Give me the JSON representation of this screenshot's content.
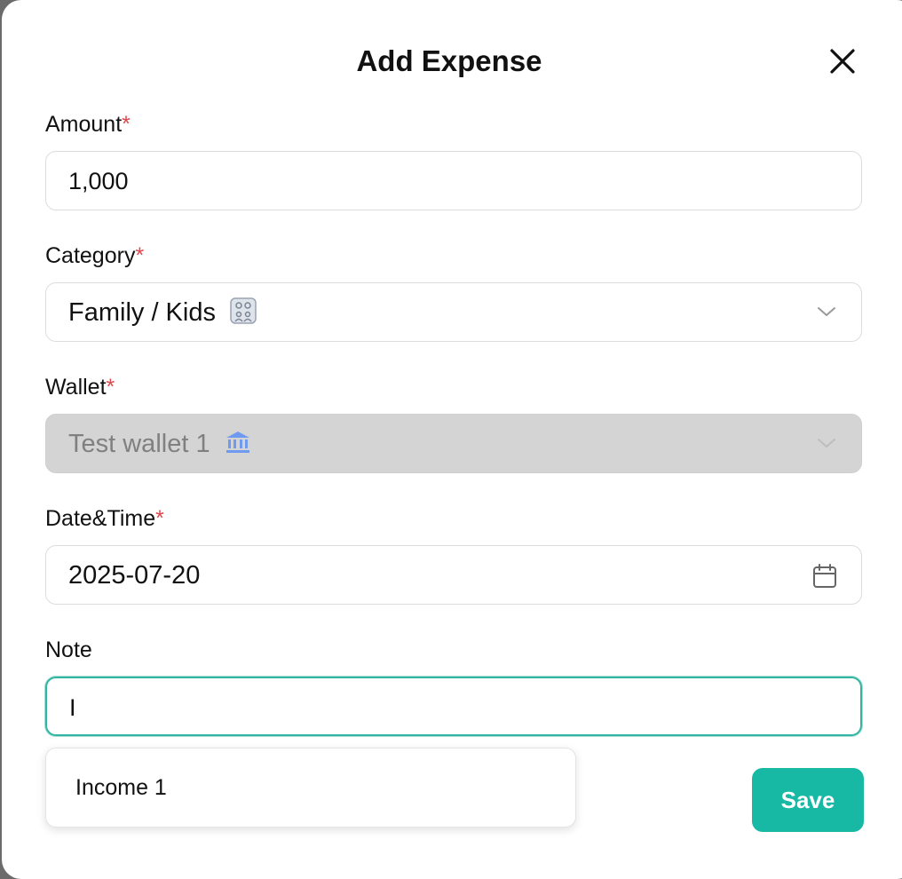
{
  "modal": {
    "title": "Add Expense",
    "close_icon": "close-icon"
  },
  "form": {
    "amount": {
      "label": "Amount",
      "required_mark": "*",
      "value": "1,000"
    },
    "category": {
      "label": "Category",
      "required_mark": "*",
      "value": "Family / Kids",
      "icon": "family-icon"
    },
    "wallet": {
      "label": "Wallet",
      "required_mark": "*",
      "value": "Test wallet 1",
      "icon": "bank-icon",
      "disabled": true
    },
    "datetime": {
      "label": "Date&Time",
      "required_mark": "*",
      "value": "2025-07-20",
      "icon": "calendar-icon"
    },
    "note": {
      "label": "Note",
      "value": "I"
    }
  },
  "autocomplete": {
    "items": [
      "Income 1"
    ]
  },
  "actions": {
    "save_label": "Save"
  },
  "colors": {
    "accent": "#17b8a4",
    "required": "#e0464c",
    "focus_border": "#34b5a3",
    "disabled_bg": "#d4d4d4",
    "bank_icon": "#5b8def"
  }
}
